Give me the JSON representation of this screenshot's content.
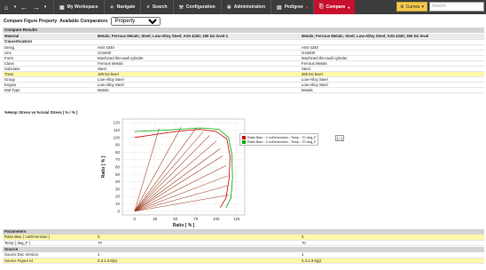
{
  "nav": {
    "items": [
      {
        "label": "My Workspace",
        "icon": "briefcase-icon"
      },
      {
        "label": "Navigate",
        "icon": "compass-icon"
      },
      {
        "label": "Search",
        "icon": "search-icon"
      },
      {
        "label": "Configuration",
        "icon": "wrench-icon"
      },
      {
        "label": "Administration",
        "icon": "gear-icon"
      },
      {
        "label": "Pedigree",
        "icon": "pedigree-icon"
      },
      {
        "label": "Compare",
        "icon": "compare-icon"
      }
    ],
    "curves_label": "Curves",
    "search_placeholder": "Search",
    "accent": "#c8102e"
  },
  "toolbar": {
    "title": "Compare Figure Property",
    "available_label": "Available Comparators",
    "selected": "Property"
  },
  "compare_results_label": "Compare Results",
  "material_row": {
    "label": "Material",
    "col1": "Metals; Ferrous Metals; Steel; Low-Alloy Steel; AISI 4340; 180 ksi level-1",
    "col2": "Metals; Ferrous Metals; Steel; Low-Alloy Steel; AISI 4340; 260 ksi level"
  },
  "classification_label": "Classification",
  "rows": [
    {
      "label": "Desig",
      "v1": "AISI 4340",
      "v2": "AISI 4340",
      "hl": false
    },
    {
      "label": "Uns",
      "v1": "G43400",
      "v2": "G43400",
      "hl": false
    },
    {
      "label": "Form",
      "v1": "Machined thin-wall cylinder",
      "v2": "Machined thin-wall cylinder",
      "hl": false
    },
    {
      "label": "Class",
      "v1": "Ferrous Metals",
      "v2": "Ferrous Metals",
      "hl": false
    },
    {
      "label": "Subclass",
      "v1": "Steel",
      "v2": "Steel",
      "hl": false
    },
    {
      "label": "Treat",
      "v1": "180 ksi level",
      "v2": "260 ksi level",
      "hl": true
    },
    {
      "label": "Group",
      "v1": "Low-Alloy Steel",
      "v2": "Low-Alloy Steel",
      "hl": false
    },
    {
      "label": "Engine",
      "v1": "Low-Alloy Steel",
      "v2": "Low-Alloy Steel",
      "hl": false
    },
    {
      "label": "Mat Type",
      "v1": "Metals",
      "v2": "Metals",
      "hl": false
    }
  ],
  "chart_row_label": "%Hoop Stress vs %Axial Stress ( % / % )",
  "chart_data": {
    "type": "line",
    "xlabel": "Ratio [ % ]",
    "ylabel": "Ratio [ % ]",
    "xlim": [
      -15,
      135
    ],
    "ylim": [
      -5,
      125
    ],
    "xticks": [
      0,
      25,
      50,
      75,
      100,
      125
    ],
    "yticks": [
      0,
      10,
      20,
      30,
      40,
      50,
      60,
      70,
      80,
      90,
      100,
      110,
      120
    ],
    "grid": true,
    "legend_position": "top-right",
    "series": [
      {
        "name": "Ratio Biax : 2 noDimension ; Temp : 70 deg_F",
        "color": "#cc0000",
        "envelope": [
          [
            0,
            100
          ],
          [
            50,
            108
          ],
          [
            80,
            111
          ],
          [
            100,
            108
          ],
          [
            113,
            98
          ],
          [
            117,
            75
          ],
          [
            116,
            45
          ],
          [
            112,
            18
          ],
          [
            105,
            5
          ]
        ]
      },
      {
        "name": "Ratio Biax : 2 noDimension ; Temp : 70 deg_F",
        "color": "#00aa00",
        "envelope": [
          [
            0,
            108
          ],
          [
            40,
            110
          ],
          [
            80,
            113
          ],
          [
            103,
            111
          ],
          [
            115,
            100
          ],
          [
            119,
            78
          ],
          [
            120,
            45
          ],
          [
            118,
            18
          ],
          [
            112,
            5
          ]
        ]
      }
    ],
    "rays": [
      [
        30,
        112
      ],
      [
        57,
        114
      ],
      [
        75,
        112
      ],
      [
        84,
        108
      ],
      [
        92,
        103
      ],
      [
        100,
        95
      ],
      [
        105,
        85
      ],
      [
        108,
        75
      ],
      [
        112,
        62
      ],
      [
        114,
        48
      ],
      [
        115,
        35
      ],
      [
        115,
        22
      ]
    ]
  },
  "legend_button_label": "[...]",
  "parameters_label": "Parameters",
  "params": [
    {
      "label": "Ratio Biax ( noDimension )",
      "v1": "0",
      "v2": "2",
      "hl": true
    },
    {
      "label": "Temp ( deg_F )",
      "v1": "70",
      "v2": "70",
      "hl": false
    }
  ],
  "source_label": "Source",
  "source_rows": [
    {
      "label": "Source Doc Version",
      "v1": "1",
      "v2": "1",
      "hl": false
    },
    {
      "label": "Source Figure Id",
      "v1": "2.3.1.3.6(a)",
      "v2": "2.3.1.3.6(g)",
      "hl": true
    }
  ]
}
